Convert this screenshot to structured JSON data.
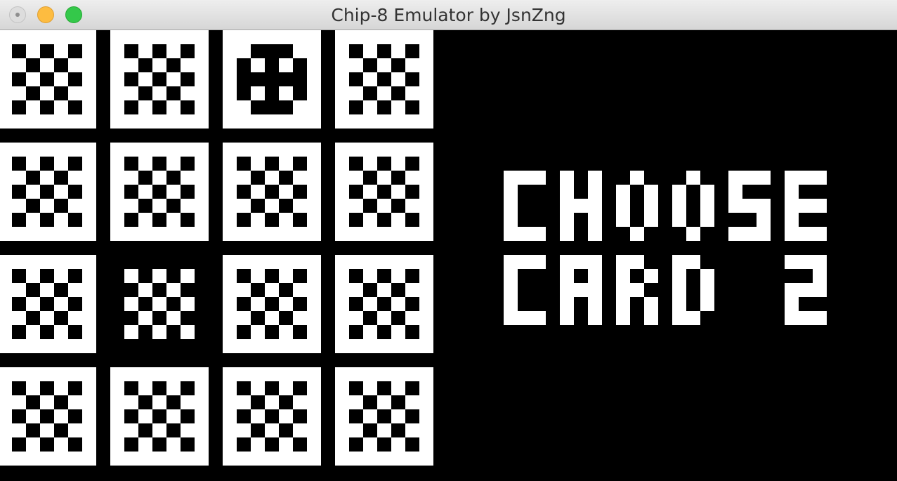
{
  "window": {
    "title": "Chip-8 Emulator by JsnZng"
  },
  "display": {
    "resolution": [
      64,
      32
    ],
    "foreground": "#ffffff",
    "background": "#000000",
    "message_lines": [
      "CHOOSE",
      "CARD 2"
    ]
  },
  "cards": {
    "rows": 4,
    "cols": 4,
    "states": [
      [
        "hidden",
        "hidden",
        "revealed",
        "hidden"
      ],
      [
        "hidden",
        "hidden",
        "hidden",
        "hidden"
      ],
      [
        "hidden",
        "selected",
        "hidden",
        "hidden"
      ],
      [
        "hidden",
        "hidden",
        "hidden",
        "hidden"
      ]
    ]
  },
  "icons": {
    "close": "close-icon",
    "minimize": "minimize-icon",
    "maximize": "maximize-icon"
  }
}
